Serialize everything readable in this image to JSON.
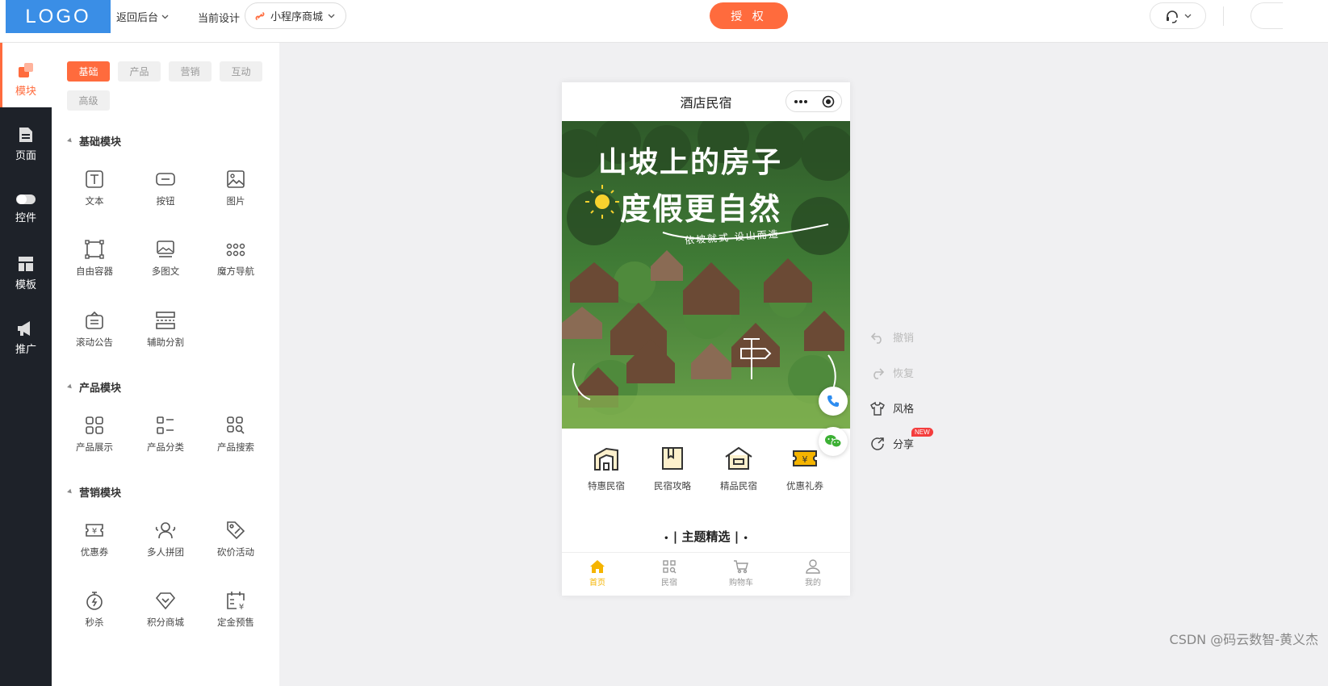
{
  "topbar": {
    "logo": "LOGO",
    "back_label": "返回后台",
    "current_label": "当前设计",
    "design_select_value": "小程序商城",
    "auth_label": "授 权"
  },
  "leftnav": {
    "items": [
      {
        "label": "模块",
        "icon": "modules-icon",
        "active": true
      },
      {
        "label": "页面",
        "icon": "page-icon"
      },
      {
        "label": "控件",
        "icon": "toggle-icon"
      },
      {
        "label": "模板",
        "icon": "template-icon"
      },
      {
        "label": "推广",
        "icon": "megaphone-icon"
      }
    ]
  },
  "panel": {
    "chips": [
      "基础",
      "产品",
      "营销",
      "互动",
      "高级"
    ],
    "sections": [
      {
        "title": "基础模块",
        "items": [
          "文本",
          "按钮",
          "图片",
          "自由容器",
          "多图文",
          "魔方导航",
          "滚动公告",
          "辅助分割"
        ]
      },
      {
        "title": "产品模块",
        "items": [
          "产品展示",
          "产品分类",
          "产品搜索"
        ]
      },
      {
        "title": "营销模块",
        "items": [
          "优惠券",
          "多人拼团",
          "砍价活动",
          "秒杀",
          "积分商城",
          "定金预售"
        ]
      }
    ]
  },
  "phone": {
    "title": "酒店民宿",
    "banner": {
      "line1": "山坡上的房子",
      "line2": "度假更自然",
      "subline": "依坡就式 设山而造"
    },
    "icons": [
      "特惠民宿",
      "民宿攻略",
      "精品民宿",
      "优惠礼券"
    ],
    "theme_title": "主题精选",
    "tabs": [
      "首页",
      "民宿",
      "购物车",
      "我的"
    ],
    "accent": "#f5b400"
  },
  "actions": {
    "undo": "撤销",
    "redo": "恢复",
    "style": "风格",
    "share": "分享",
    "new_badge": "NEW"
  },
  "colors": {
    "primary": "#ff6b3d",
    "logo_bg": "#3a8ee6",
    "nav_bg": "#1e2229"
  },
  "watermark": "CSDN @码云数智-黄义杰"
}
